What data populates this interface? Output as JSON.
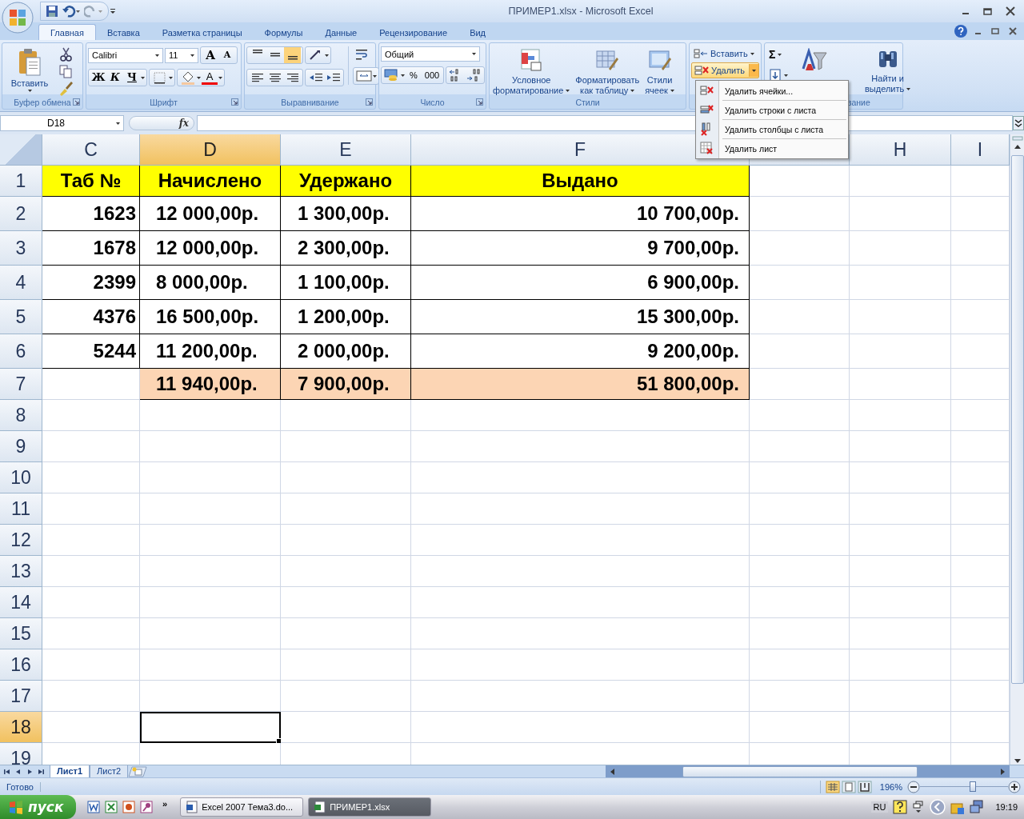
{
  "window": {
    "title": "ПРИМЕР1.xlsx - Microsoft Excel"
  },
  "ribbon_tabs": [
    {
      "label": "Главная",
      "selected": true
    },
    {
      "label": "Вставка",
      "selected": false
    },
    {
      "label": "Разметка страницы",
      "selected": false
    },
    {
      "label": "Формулы",
      "selected": false
    },
    {
      "label": "Данные",
      "selected": false
    },
    {
      "label": "Рецензирование",
      "selected": false
    },
    {
      "label": "Вид",
      "selected": false
    }
  ],
  "ribbon": {
    "clipboard": {
      "label": "Буфер обмена",
      "paste": "Вставить"
    },
    "font": {
      "label": "Шрифт",
      "font_name": "Calibri",
      "font_size": "11",
      "grow": "A",
      "shrink": "A",
      "bold": "Ж",
      "italic": "К",
      "underline": "Ч",
      "font_color": "A"
    },
    "alignment": {
      "label": "Выравнивание",
      "vertical": [
        {
          "selected": false
        },
        {
          "selected": false
        },
        {
          "selected": true
        }
      ]
    },
    "number": {
      "label": "Число",
      "format": "Общий",
      "percent": "%",
      "thousands": "000"
    },
    "styles": {
      "label": "Стили",
      "buttons": [
        {
          "lines": [
            "Условное",
            "форматирование"
          ]
        },
        {
          "lines": [
            "Форматировать",
            "как таблицу"
          ]
        },
        {
          "lines": [
            "Стили",
            "ячеек"
          ]
        }
      ]
    },
    "cells": {
      "insert": "Вставить",
      "delete": "Удалить"
    },
    "editing": {
      "sum": "Σ",
      "find": [
        "Найти и",
        "выделить"
      ],
      "label_fragment": "вание"
    }
  },
  "delete_menu": {
    "items": [
      "Удалить ячейки...",
      "Удалить строки с листа",
      "Удалить столбцы с листа",
      "Удалить лист"
    ]
  },
  "formula_bar": {
    "name_box": "D18",
    "fx": "fx"
  },
  "grid": {
    "columns": [
      {
        "label": "C",
        "selected": false
      },
      {
        "label": "D",
        "selected": true
      },
      {
        "label": "E",
        "selected": false
      },
      {
        "label": "F",
        "selected": false
      },
      {
        "selected": false
      },
      {
        "label": "H",
        "selected": false
      },
      {
        "label": "I",
        "selected": false
      }
    ],
    "rows": [
      {
        "header": "1",
        "selected": false,
        "kind": "heading",
        "cells": [
          "Таб №",
          "Начислено",
          "Удержано",
          "Выдано"
        ]
      },
      {
        "header": "2",
        "selected": false,
        "kind": "data",
        "cells": [
          "1623",
          "12 000,00р.",
          "1 300,00р.",
          "10 700,00р."
        ]
      },
      {
        "header": "3",
        "selected": false,
        "kind": "data",
        "cells": [
          "1678",
          "12 000,00р.",
          "2 300,00р.",
          "9 700,00р."
        ]
      },
      {
        "header": "4",
        "selected": false,
        "kind": "data",
        "cells": [
          "2399",
          "8 000,00р.",
          "1 100,00р.",
          "6 900,00р."
        ]
      },
      {
        "header": "5",
        "selected": false,
        "kind": "data",
        "cells": [
          "4376",
          "16 500,00р.",
          "1 200,00р.",
          "15 300,00р."
        ]
      },
      {
        "header": "6",
        "selected": false,
        "kind": "data",
        "cells": [
          "5244",
          "11 200,00р.",
          "2 000,00р.",
          "9 200,00р."
        ]
      },
      {
        "header": "7",
        "selected": false,
        "kind": "total",
        "cells": [
          null,
          "11 940,00р.",
          "7 900,00р.",
          "51 800,00р."
        ]
      },
      {
        "header": "8",
        "selected": false,
        "kind": "empty"
      },
      {
        "header": "9",
        "selected": false,
        "kind": "empty"
      },
      {
        "header": "10",
        "selected": false,
        "kind": "empty"
      },
      {
        "header": "11",
        "selected": false,
        "kind": "empty"
      },
      {
        "header": "12",
        "selected": false,
        "kind": "empty"
      },
      {
        "header": "13",
        "selected": false,
        "kind": "empty"
      },
      {
        "header": "14",
        "selected": false,
        "kind": "empty"
      },
      {
        "header": "15",
        "selected": false,
        "kind": "empty"
      },
      {
        "header": "16",
        "selected": false,
        "kind": "empty"
      },
      {
        "header": "17",
        "selected": false,
        "kind": "empty"
      },
      {
        "header": "18",
        "selected": true,
        "kind": "empty"
      },
      {
        "header": "19",
        "selected": false,
        "kind": "empty"
      }
    ]
  },
  "sheet_tabs": [
    {
      "label": "Лист1",
      "selected": true
    },
    {
      "label": "Лист2",
      "selected": false
    }
  ],
  "status_bar": {
    "status": "Готово",
    "zoom": "196%",
    "zoom_slider": {
      "level": 0.6
    }
  },
  "taskbar": {
    "start": "пуск",
    "more": "»",
    "tasks": [
      {
        "label": "Excel 2007 Тема3.do...",
        "selected": false
      },
      {
        "label": "ПРИМЕР1.xlsx",
        "selected": true
      }
    ],
    "language": "RU",
    "clock": "19:19"
  }
}
